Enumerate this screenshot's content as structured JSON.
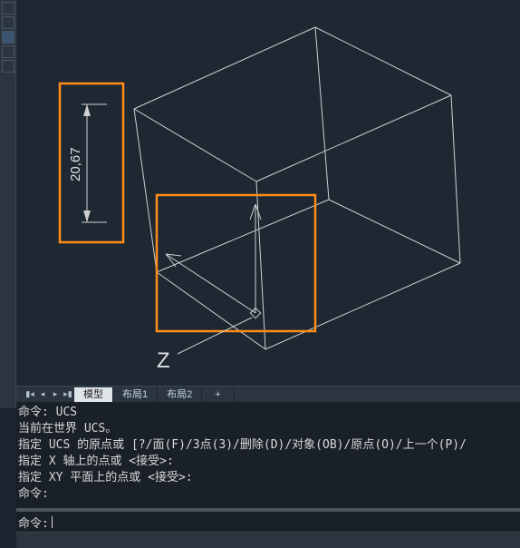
{
  "tabs": {
    "model": "模型",
    "layout1": "布局1",
    "layout2": "布局2",
    "add": "+"
  },
  "dimension": {
    "value": "20,67"
  },
  "ucs_axis_label": "Z",
  "command_history": {
    "l1": "命令: UCS",
    "l2": "当前在世界 UCS。",
    "l3": "指定 UCS 的原点或 [?/面(F)/3点(3)/删除(D)/对象(OB)/原点(O)/上一个(P)/",
    "l4": "指定 X 轴上的点或 <接受>:",
    "l5": "指定 XY 平面上的点或 <接受>:",
    "l6": "命令:"
  },
  "command_input": {
    "prompt": "命令:",
    "value": ""
  }
}
